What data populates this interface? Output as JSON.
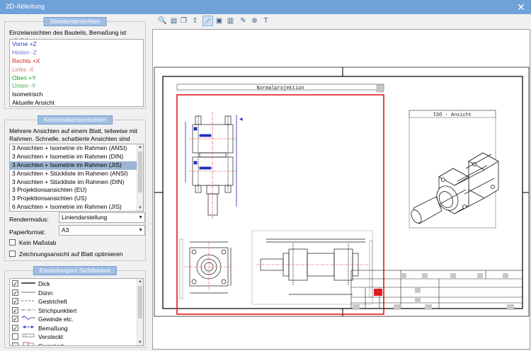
{
  "window": {
    "title": "2D-Ableitung",
    "close_glyph": "✕"
  },
  "standard_views": {
    "title": "Standardansichten",
    "description": "Einzelansichten des Bauteils, Bemaßung ist möglich.",
    "items": [
      {
        "label": "Vorne +Z",
        "color": "#2d38c9"
      },
      {
        "label": "Hinten -Z",
        "color": "#6a74d8"
      },
      {
        "label": "Rechts +X",
        "color": "#d62020"
      },
      {
        "label": "Links -X",
        "color": "#e07a7a"
      },
      {
        "label": "Oben +Y",
        "color": "#1e9a28"
      },
      {
        "label": "Unten -Y",
        "color": "#46b24e"
      },
      {
        "label": "Isometrisch",
        "color": "#000000"
      },
      {
        "label": "Aktuelle Ansicht",
        "color": "#000000"
      }
    ]
  },
  "combination_views": {
    "title": "Kombinationsansichten",
    "description_line1": "Mehrere Ansichten auf einem Blatt, teilweise mit",
    "description_line2": "Rahmen. Schnelle, schattierte Ansichten sind möglich.",
    "items": [
      "3 Ansichten + Isometrie im Rahmen (ANSI)",
      "3 Ansichten + Isometrie im Rahmen (DIN)",
      "3 Ansichten + Isometrie im Rahmen (JIS)",
      "3 Ansichten + Stückliste im Rahmen (ANSI)",
      "3 Ansichten + Stückliste im Rahmen (DIN)",
      "3 Projektionsansichten (EU)",
      "3 Projektionsansichten (US)",
      "6 Ansichten + Isometrie im Rahmen (JIS)"
    ],
    "selected_index": 2,
    "render_mode_label": "Rendermodus:",
    "render_mode_value": "Liniendarstellung",
    "paper_format_label": "Papierformat:",
    "paper_format_value": "A3",
    "no_scale_label": "Kein Maßstab",
    "optimize_label": "Zeichnungsansicht auf Blatt optimieren"
  },
  "visibility": {
    "title": "Einstellungen/ Sichtbarkeit",
    "items": [
      {
        "label": "Dick",
        "checked": true,
        "sample": "thick"
      },
      {
        "label": "Dünn",
        "checked": true,
        "sample": "thin"
      },
      {
        "label": "Gestrichelt",
        "checked": true,
        "sample": "dashed"
      },
      {
        "label": "Strichpunktiert",
        "checked": true,
        "sample": "dashdot"
      },
      {
        "label": "Gewinde etc.",
        "checked": true,
        "sample": "thread"
      },
      {
        "label": "Bemaßung",
        "checked": true,
        "sample": "dimension"
      },
      {
        "label": "Versteckt",
        "checked": false,
        "sample": "hidden"
      },
      {
        "label": "Gruppiert",
        "checked": false,
        "sample": "grouped"
      }
    ]
  },
  "toolbar": {
    "buttons": [
      {
        "name": "zoom-icon",
        "glyph": "🔍"
      },
      {
        "name": "print-preview-icon",
        "glyph": "▤"
      },
      {
        "name": "copy-icon",
        "glyph": "❐"
      },
      {
        "name": "export-icon",
        "glyph": "⇪"
      },
      {
        "name": "measure-icon",
        "glyph": "⟋",
        "active": true
      },
      {
        "name": "save-icon",
        "glyph": "▣"
      },
      {
        "name": "layers-icon",
        "glyph": "▥"
      },
      {
        "name": "edit-icon",
        "glyph": "✎"
      },
      {
        "name": "delete-icon",
        "glyph": "⊗"
      },
      {
        "name": "text-icon",
        "glyph": "T"
      }
    ]
  },
  "drawing": {
    "normal_projection_label": "Normalprojektion",
    "iso_view_label": "ISO - Ansicht",
    "frame_color": "#e01c1c",
    "line_color": "#1a1a1a",
    "center_color": "#e04040",
    "dim_color": "#2030c0"
  }
}
